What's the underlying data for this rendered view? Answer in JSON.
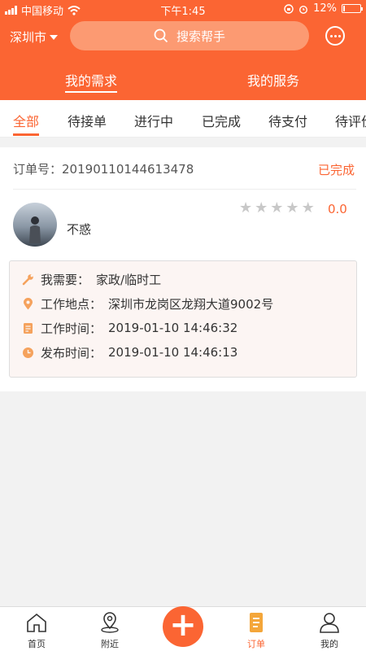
{
  "status_bar": {
    "carrier": "中国移动",
    "time": "下午1:45",
    "battery": "12%",
    "battery_level": 0.12
  },
  "header": {
    "city": "深圳市",
    "search_placeholder": "搜索帮手",
    "tabs": [
      {
        "label": "我的需求",
        "active": true
      },
      {
        "label": "我的服务",
        "active": false
      }
    ]
  },
  "sub_tabs": [
    {
      "label": "全部",
      "active": true
    },
    {
      "label": "待接单"
    },
    {
      "label": "进行中"
    },
    {
      "label": "已完成"
    },
    {
      "label": "待支付"
    },
    {
      "label": "待评价"
    }
  ],
  "order": {
    "number_label": "订单号：",
    "number": "20190110144613478",
    "status": "已完成",
    "user_name": "不惑",
    "rating": "0.0",
    "stars_total": 5,
    "stars_filled": 0,
    "details": [
      {
        "icon": "wrench-icon",
        "label": "我需要：",
        "value": "家政/临时工"
      },
      {
        "icon": "location-pin-icon",
        "label": "工作地点：",
        "value": "深圳市龙岗区龙翔大道9002号"
      },
      {
        "icon": "work-time-icon",
        "label": "工作时间：",
        "value": "2019-01-10 14:46:32"
      },
      {
        "icon": "clock-icon",
        "label": "发布时间：",
        "value": "2019-01-10 14:46:13"
      }
    ]
  },
  "tab_bar": [
    {
      "label": "首页",
      "icon": "home-icon"
    },
    {
      "label": "附近",
      "icon": "nearby-pin-icon"
    },
    {
      "label": "",
      "icon": "plus-icon"
    },
    {
      "label": "订单",
      "icon": "order-icon",
      "active": true
    },
    {
      "label": "我的",
      "icon": "profile-icon"
    }
  ],
  "colors": {
    "accent": "#fb6533",
    "search_bg": "#fc9a72",
    "info_bg": "#fcf5f3",
    "icon_orange": "#f5a25d"
  }
}
